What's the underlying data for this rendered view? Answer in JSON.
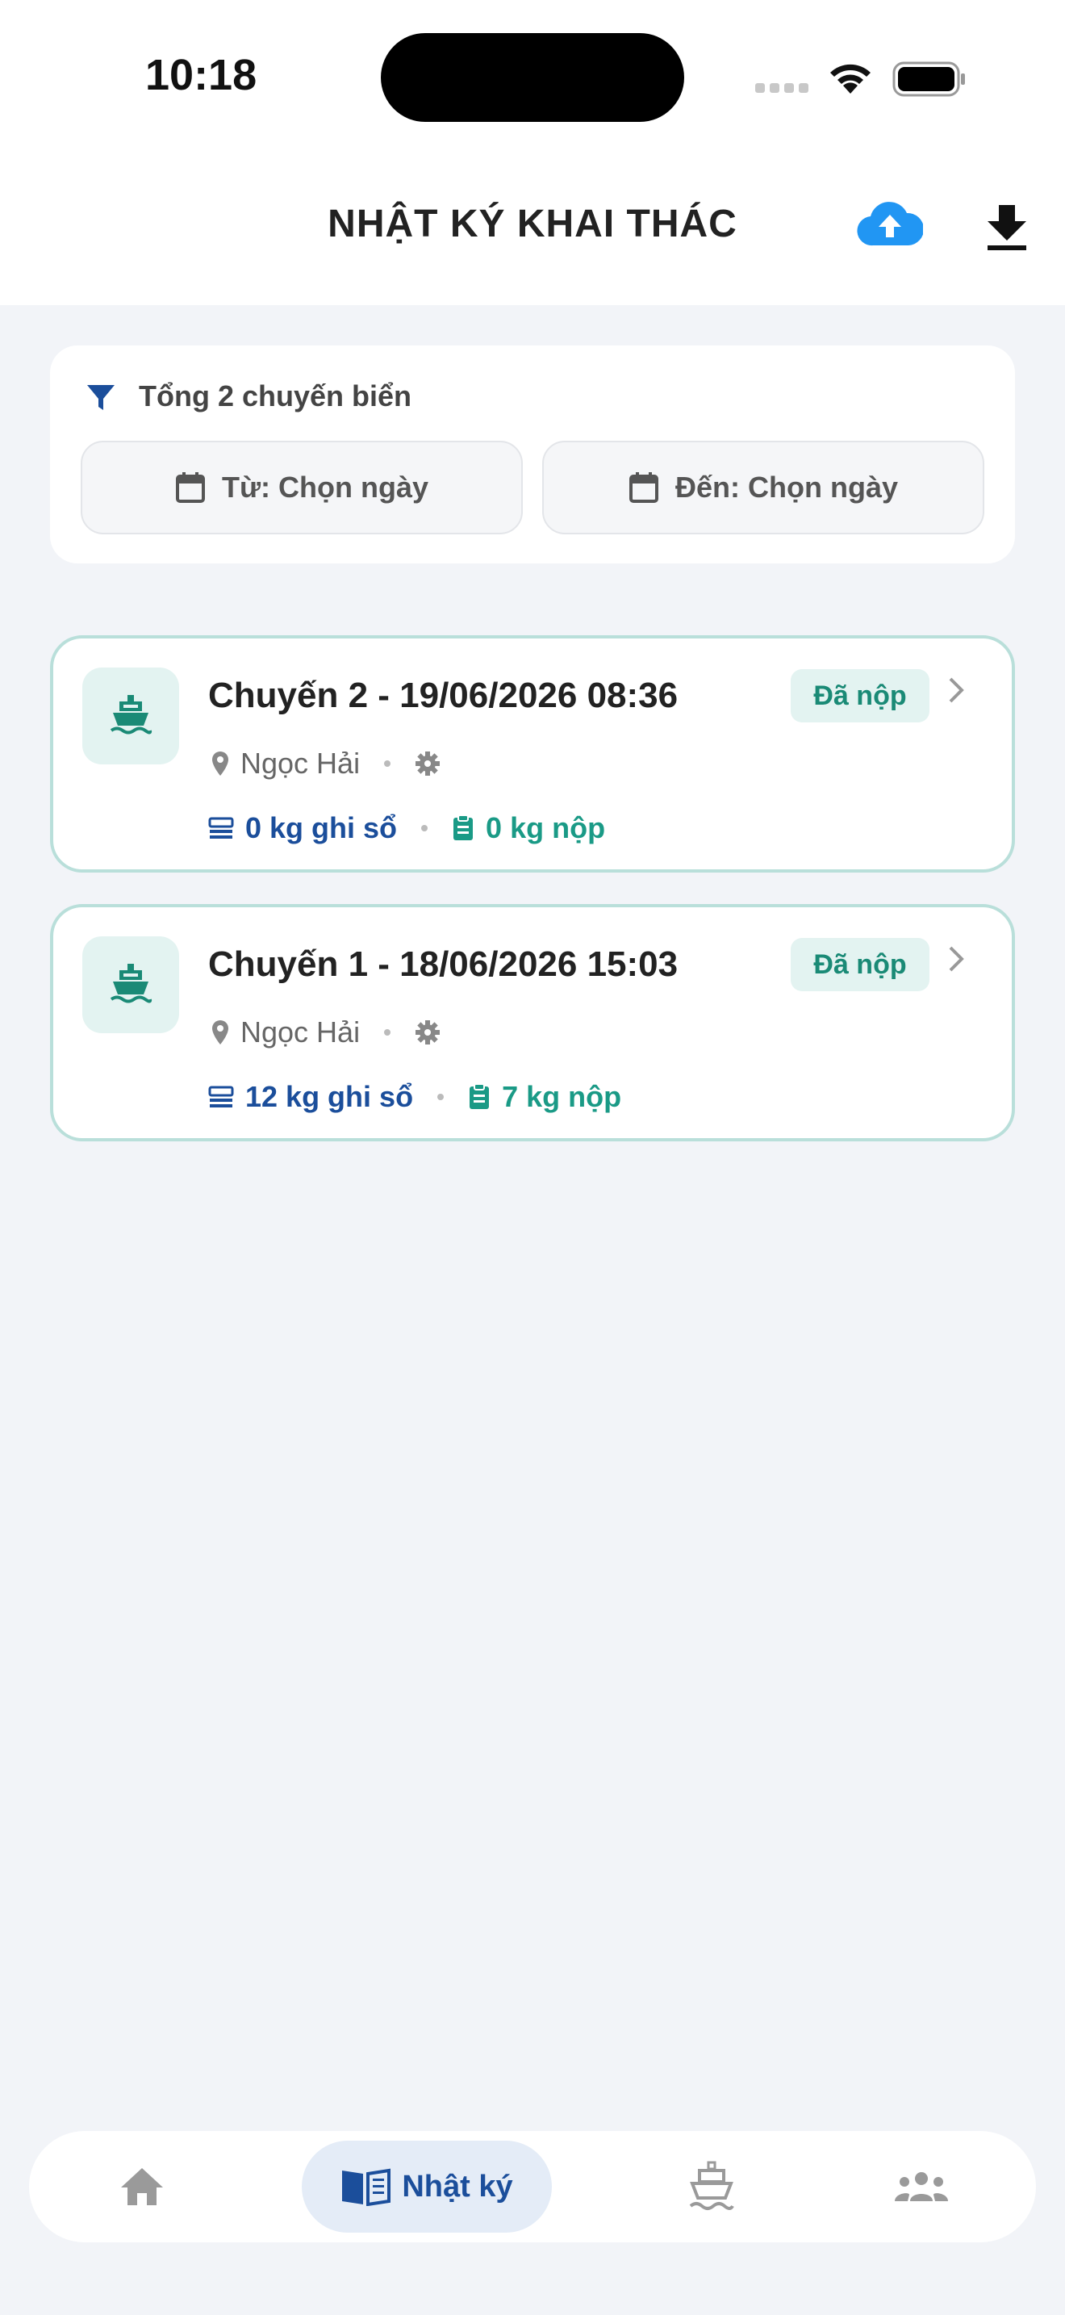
{
  "status_bar": {
    "time": "10:18"
  },
  "header": {
    "title": "NHẬT KÝ KHAI THÁC"
  },
  "filter": {
    "count_label": "Tổng 2 chuyến biển",
    "from_label": "Từ: Chọn ngày",
    "to_label": "Đến: Chọn ngày"
  },
  "trips": [
    {
      "title": "Chuyến 2 - 19/06/2026 08:36",
      "status": "Đã nộp",
      "location": "Ngọc Hải",
      "logged": "0 kg ghi sổ",
      "submitted": "0 kg nộp"
    },
    {
      "title": "Chuyến 1 - 18/06/2026 15:03",
      "status": "Đã nộp",
      "location": "Ngọc Hải",
      "logged": "12 kg ghi sổ",
      "submitted": "7 kg nộp"
    }
  ],
  "nav": {
    "diary_label": "Nhật ký"
  },
  "colors": {
    "primary_blue": "#1b4e9b",
    "teal": "#1a8a76",
    "cloud_blue": "#2196f3",
    "background": "#f2f4f8"
  }
}
